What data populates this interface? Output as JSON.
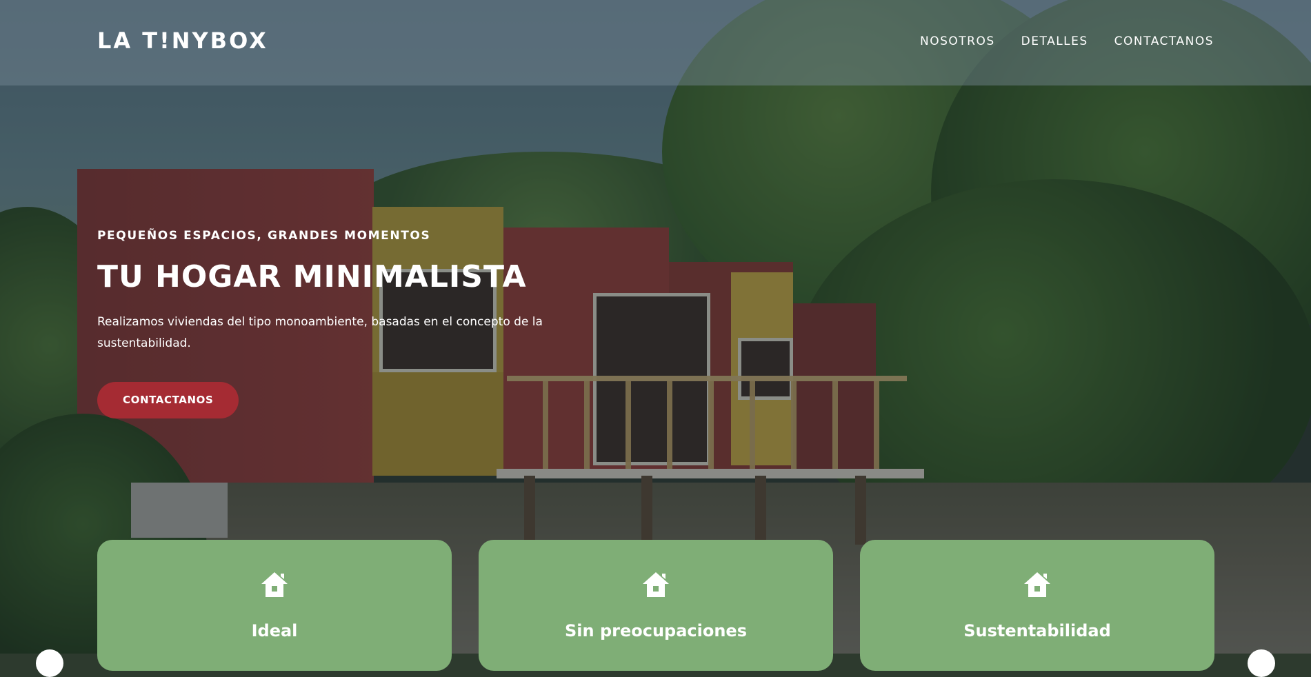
{
  "header": {
    "logo": "LA T!NYBOX",
    "nav": [
      "NOSOTROS",
      "DETALLES",
      "CONTACTANOS"
    ]
  },
  "hero": {
    "eyebrow": "PEQUEÑOS ESPACIOS, GRANDES MOMENTOS",
    "headline": "TU HOGAR MINIMALISTA",
    "lead": "Realizamos viviendas del tipo monoambiente, basadas en el concepto de la sustentabilidad.",
    "cta": "CONTACTANOS"
  },
  "features": [
    {
      "icon": "house-icon",
      "title": "Ideal"
    },
    {
      "icon": "house-icon",
      "title": "Sin preocupaciones"
    },
    {
      "icon": "house-icon",
      "title": "Sustentabilidad"
    }
  ],
  "colors": {
    "accent": "#a52b33",
    "card": "#7fae76",
    "navbar": "rgba(120,138,150,0.45)"
  }
}
